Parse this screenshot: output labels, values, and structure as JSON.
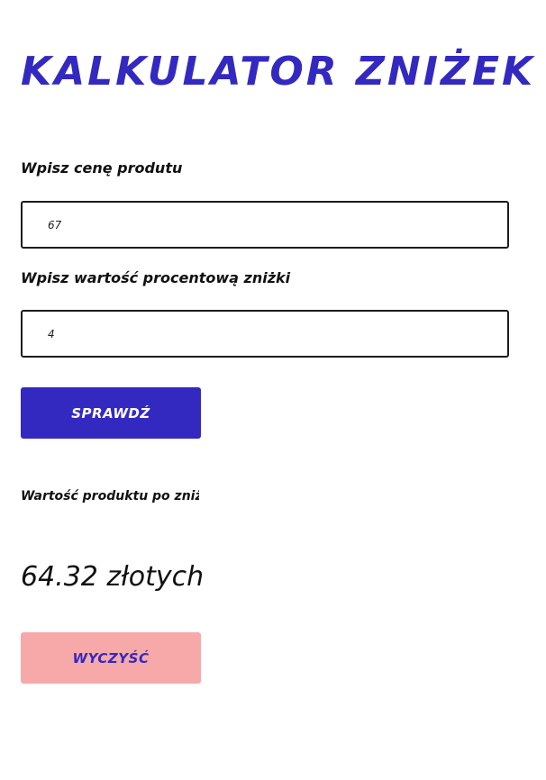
{
  "app": {
    "title": "KALKULATOR ZNIŻEK"
  },
  "form": {
    "price_label": "Wpisz cenę produtu",
    "price_value": "67",
    "percent_label": "Wpisz wartość procentową zniżki",
    "percent_value": "4",
    "check_button_label": "SPRAWDŹ"
  },
  "result": {
    "label": "Wartość produktu po zniżce:",
    "value": "64.32 złotych"
  },
  "actions": {
    "clear_button_label": "WYCZYŚĆ"
  },
  "colors": {
    "accent": "#3329c0",
    "text": "#111111",
    "clear_button_bg": "#f7a9a9",
    "check_button_text": "#ffffff",
    "clear_button_text": "#3329c0",
    "input_border": "#1c1c1c"
  }
}
